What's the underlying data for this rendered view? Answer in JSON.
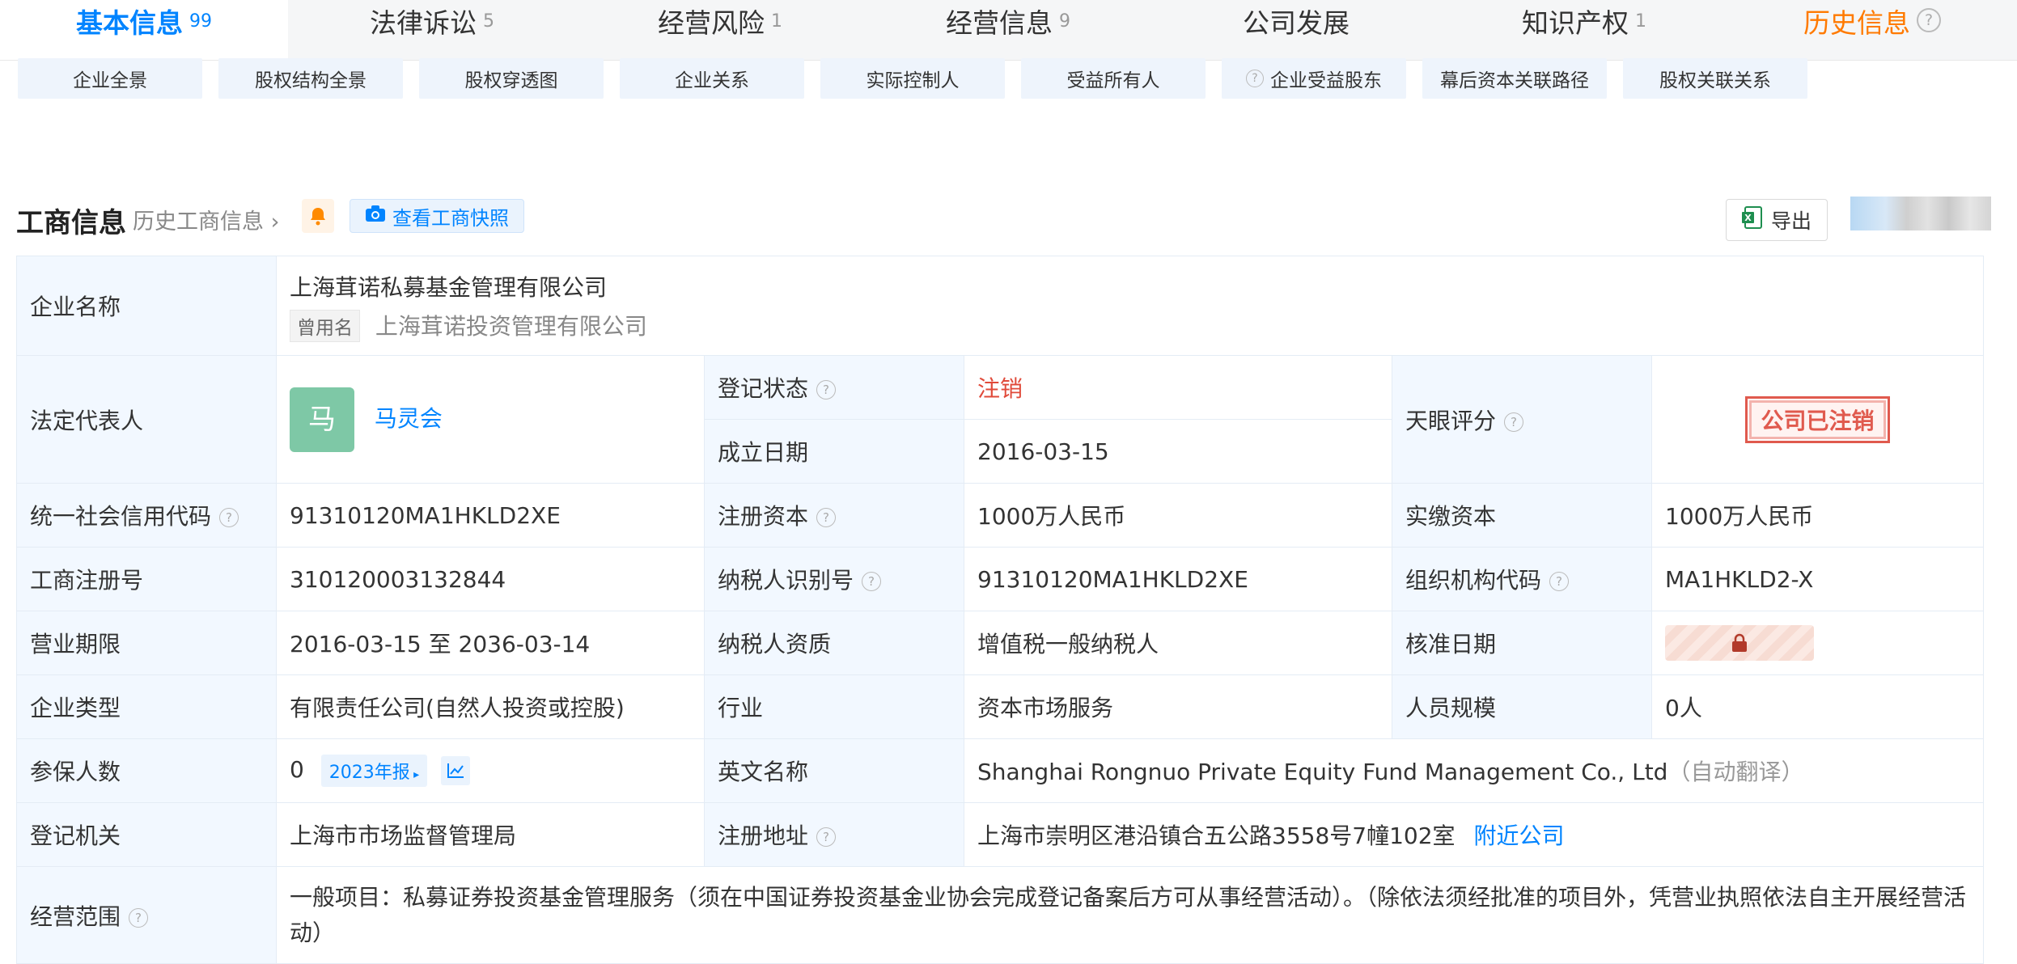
{
  "tabs": [
    {
      "label": "基本信息",
      "count": "99"
    },
    {
      "label": "法律诉讼",
      "count": "5"
    },
    {
      "label": "经营风险",
      "count": "1"
    },
    {
      "label": "经营信息",
      "count": "9"
    },
    {
      "label": "公司发展",
      "count": ""
    },
    {
      "label": "知识产权",
      "count": "1"
    },
    {
      "label": "历史信息",
      "count": ""
    }
  ],
  "subbuttons": [
    "企业全景",
    "股权结构全景",
    "股权穿透图",
    "企业关系",
    "实际控制人",
    "受益所有人",
    "企业受益股东",
    "幕后资本关联路径",
    "股权关联关系"
  ],
  "section": {
    "title": "工商信息",
    "history_link": "历史工商信息",
    "snapshot_label": "查看工商快照",
    "export_label": "导出"
  },
  "company": {
    "name_label": "企业名称",
    "name": "上海茸诺私募基金管理有限公司",
    "used_name_tag": "曾用名",
    "used_name": "上海茸诺投资管理有限公司",
    "legal_rep_label": "法定代表人",
    "legal_rep_avatar": "马",
    "legal_rep": "马灵会",
    "reg_status_label": "登记状态",
    "reg_status": "注销",
    "founded_label": "成立日期",
    "founded": "2016-03-15",
    "score_label": "天眼评分",
    "score_stamp": "公司已注销",
    "credit_code_label": "统一社会信用代码",
    "credit_code": "91310120MA1HKLD2XE",
    "reg_capital_label": "注册资本",
    "reg_capital": "1000万人民币",
    "paid_capital_label": "实缴资本",
    "paid_capital": "1000万人民币",
    "biz_reg_no_label": "工商注册号",
    "biz_reg_no": "310120003132844",
    "taxpayer_id_label": "纳税人识别号",
    "taxpayer_id": "91310120MA1HKLD2XE",
    "org_code_label": "组织机构代码",
    "org_code": "MA1HKLD2-X",
    "term_label": "营业期限",
    "term": "2016-03-15 至 2036-03-14",
    "tax_qual_label": "纳税人资质",
    "tax_qual": "增值税一般纳税人",
    "approve_label": "核准日期",
    "type_label": "企业类型",
    "type": "有限责任公司(自然人投资或控股)",
    "industry_label": "行业",
    "industry": "资本市场服务",
    "staff_label": "人员规模",
    "staff": "0人",
    "insured_label": "参保人数",
    "insured": "0",
    "report_label": "2023年报",
    "en_name_label": "英文名称",
    "en_name": "Shanghai Rongnuo Private Equity Fund Management Co., Ltd",
    "auto_translate": "（自动翻译）",
    "authority_label": "登记机关",
    "authority": "上海市市场监督管理局",
    "address_label": "注册地址",
    "address": "上海市崇明区港沿镇合五公路3558号7幢102室",
    "nearby_label": "附近公司",
    "scope_label": "经营范围",
    "scope": "一般项目：私募证券投资基金管理服务（须在中国证券投资基金业协会完成登记备案后方可从事经营活动）。（除依法须经批准的项目外，凭营业执照依法自主开展经营活动）"
  },
  "colors": {
    "accent": "#0084ff",
    "history": "#ff7a00",
    "cancelled": "#e04a3a",
    "avatar": "#7ec8a6"
  }
}
